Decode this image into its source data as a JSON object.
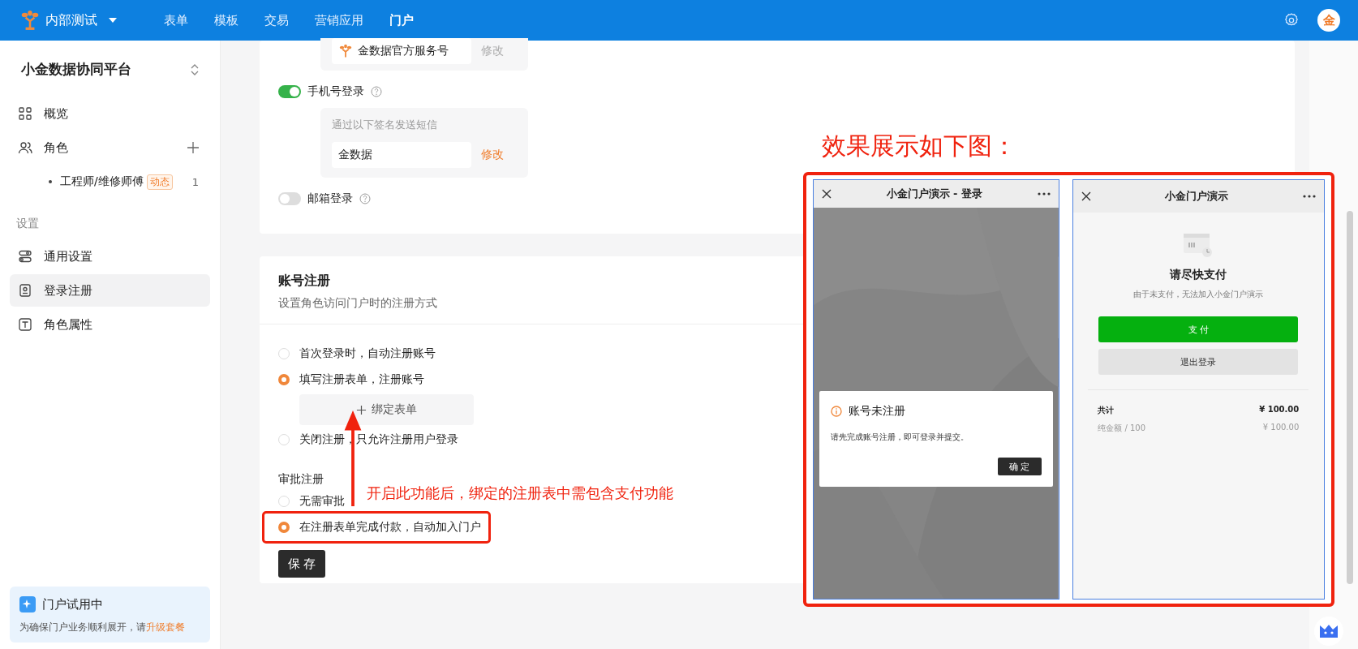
{
  "topbar": {
    "app_name": "内部测试",
    "nav": [
      {
        "label": "表单",
        "selected": false
      },
      {
        "label": "模板",
        "selected": false
      },
      {
        "label": "交易",
        "selected": false
      },
      {
        "label": "营销应用",
        "selected": false
      },
      {
        "label": "门户",
        "selected": true
      }
    ],
    "avatar_text": "金"
  },
  "sidebar": {
    "workspace": "小金数据协同平台",
    "items": [
      {
        "kind": "item",
        "label": "概览",
        "selected": false,
        "add": false
      },
      {
        "kind": "item",
        "label": "角色",
        "selected": false,
        "add": true
      },
      {
        "kind": "child",
        "label": "工程师/维修师傅",
        "tag": "动态",
        "count": "1"
      },
      {
        "kind": "section",
        "label": "设置"
      },
      {
        "kind": "item",
        "label": "通用设置",
        "selected": false,
        "add": false
      },
      {
        "kind": "item",
        "label": "登录注册",
        "selected": true,
        "add": false
      },
      {
        "kind": "item",
        "label": "角色属性",
        "selected": false,
        "add": false
      }
    ],
    "notice": {
      "title": "门户试用中",
      "text": "为确保门户业务顺利展开，请",
      "link": "升级套餐"
    }
  },
  "login": {
    "account_field": {
      "value": "金数据官方服务号",
      "action": "修改",
      "disabled": true
    },
    "methods": [
      {
        "label": "手机号登录",
        "on": true,
        "hint": "通过以下签名发送短信",
        "value": "金数据",
        "action": "修改",
        "disabled": false
      },
      {
        "label": "邮箱登录",
        "on": false
      }
    ]
  },
  "registration": {
    "title": "账号注册",
    "subtitle": "设置角色访问门户时的注册方式",
    "options": [
      {
        "label": "首次登录时，自动注册账号",
        "selected": false
      },
      {
        "label": "填写注册表单，注册账号",
        "selected": true,
        "bind_button": "绑定表单"
      },
      {
        "label": "关闭注册，只允许注册用户登录",
        "selected": false
      }
    ],
    "approval_label": "审批注册",
    "approval_options": [
      {
        "label": "无需审批",
        "selected": false
      },
      {
        "label": "在注册表单完成付款，自动加入门户",
        "selected": true
      }
    ],
    "save": "保 存"
  },
  "annotation": {
    "note": "开启此功能后，绑定的注册表中需包含支付功能",
    "showcase_title": "效果展示如下图："
  },
  "phones": [
    {
      "kind": "dialog",
      "title": "小金门户演示 - 登录",
      "dialog_title": "账号未注册",
      "dialog_text": "请先完成账号注册，即可登录并提交。",
      "dialog_button": "确 定"
    },
    {
      "kind": "payment",
      "title": "小金门户演示",
      "heading": "请尽快支付",
      "subtitle": "由于未支付，无法加入小金门户演示",
      "pay_button": "支 付",
      "logout_button": "退出登录",
      "rows": [
        {
          "label": "共计",
          "amount": "¥ 100.00"
        },
        {
          "label": "纯金额 / 100",
          "amount": "¥ 100.00"
        }
      ]
    }
  ]
}
